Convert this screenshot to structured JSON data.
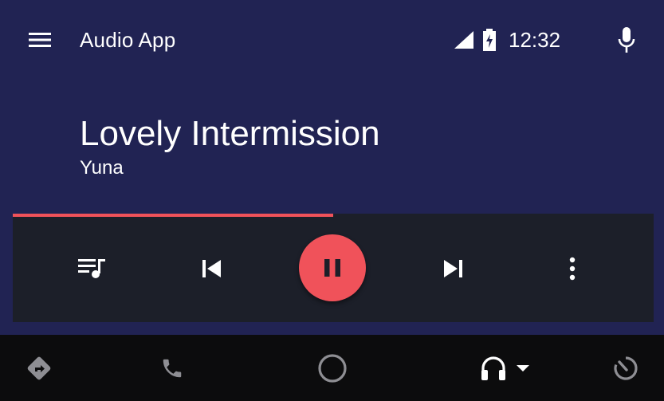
{
  "app": {
    "title": "Audio App"
  },
  "status_bar": {
    "time": "12:32",
    "icons": [
      "signal-icon",
      "battery-charging-icon"
    ]
  },
  "now_playing": {
    "title": "Lovely Intermission",
    "artist": "Yuna",
    "progress_fraction": 0.5,
    "state": "playing"
  },
  "playback_controls": {
    "items": [
      "queue-music-icon",
      "skip-previous-icon",
      "pause-icon",
      "skip-next-icon",
      "more-vert-icon"
    ]
  },
  "nav_bar": {
    "items": [
      "navigation-icon",
      "phone-icon",
      "home-circle-icon",
      "headphones-icon",
      "exit-icon"
    ],
    "active": "headphones-icon"
  },
  "colors": {
    "background": "#212353",
    "control_bar": "#1c1f29",
    "accent": "#f0525a",
    "nav_bar": "#0c0c0d",
    "nav_icon": "#8e8e93"
  }
}
